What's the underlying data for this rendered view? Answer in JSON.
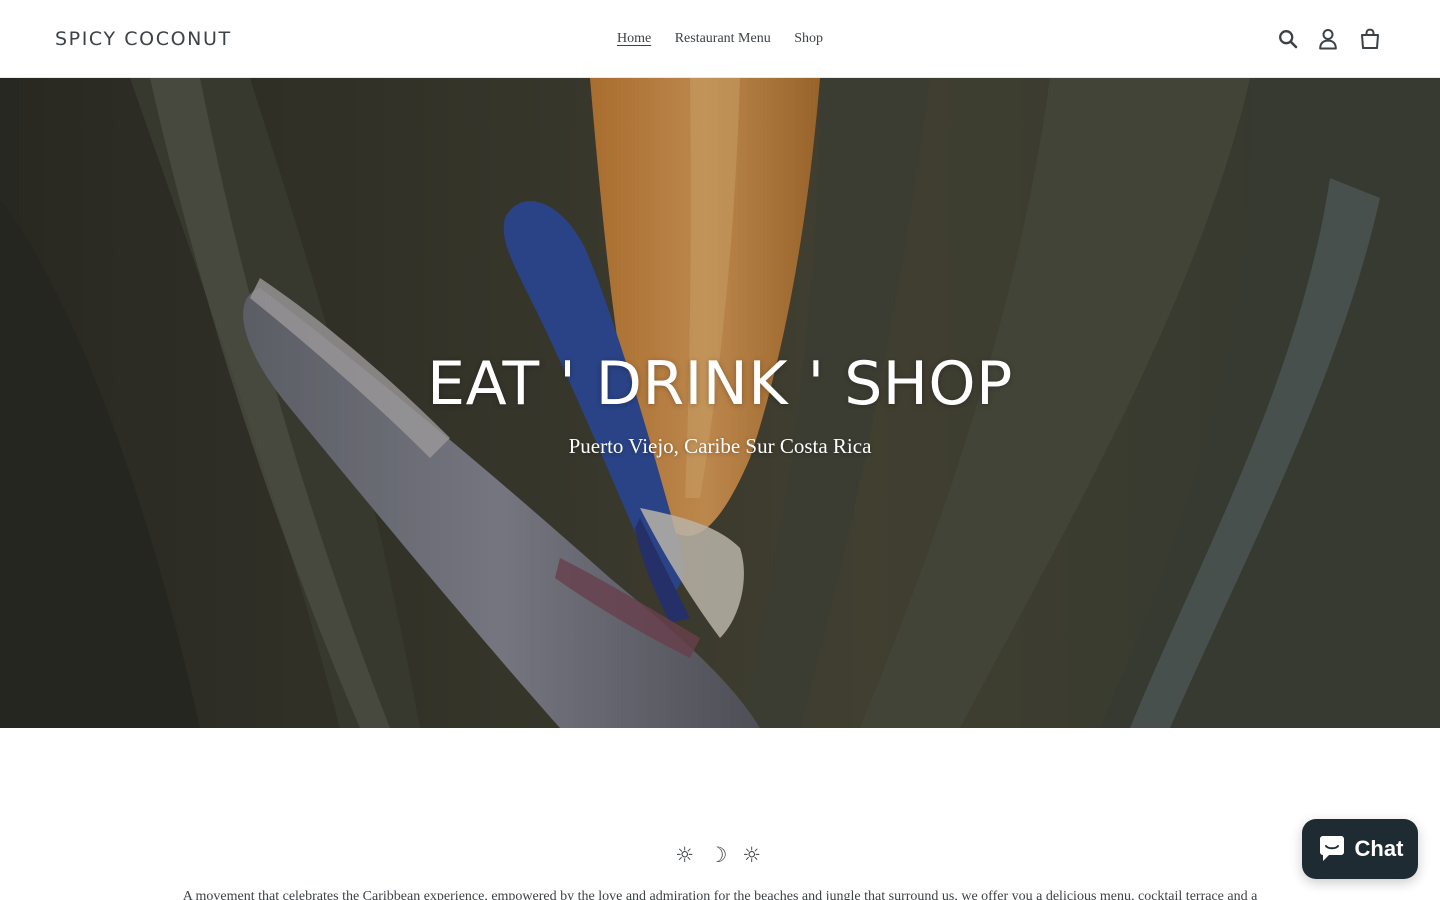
{
  "header": {
    "logo_text": "SPICY COCONUT",
    "nav": [
      {
        "label": "Home",
        "active": true
      },
      {
        "label": "Restaurant Menu",
        "active": false
      },
      {
        "label": "Shop",
        "active": false
      }
    ],
    "icons": [
      "search-icon",
      "account-icon",
      "cart-icon"
    ]
  },
  "hero": {
    "title": "EAT ' DRINK ' SHOP",
    "subtitle": "Puerto Viejo, Caribe Sur Costa Rica"
  },
  "intro": {
    "symbols": "☼ ☽ ☼",
    "text": "A movement that celebrates the Caribbean experience, empowered by the love and admiration for the beaches and jungle that surround us, we offer you a delicious menu, cocktail terrace and a"
  },
  "chat": {
    "label": "Chat"
  },
  "colors": {
    "text": "#3d4246",
    "chat_bg": "#1f2b33",
    "hero_orange": "#d98a3a",
    "hero_blue": "#3554a8"
  }
}
